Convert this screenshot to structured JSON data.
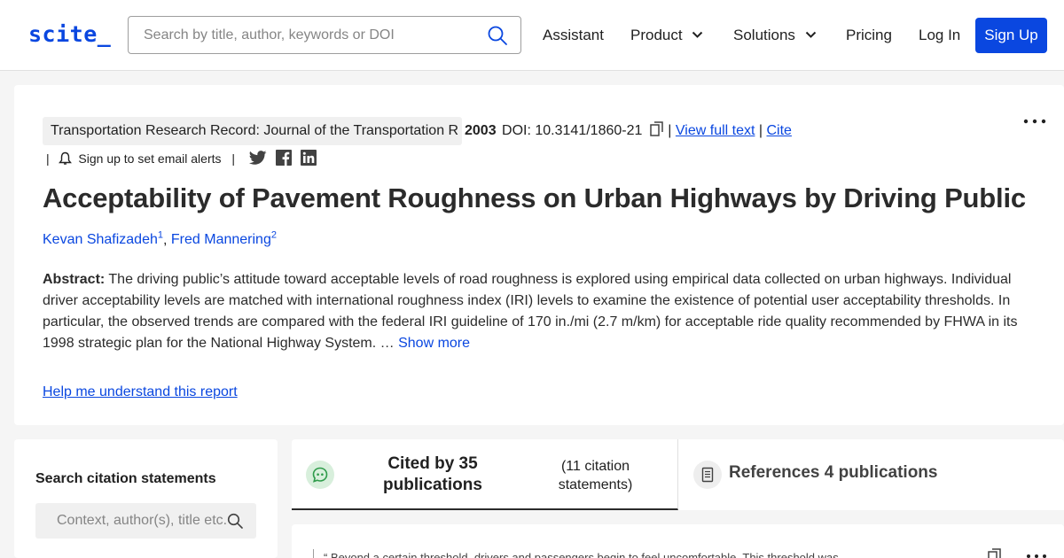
{
  "header": {
    "logo": "scite_",
    "search_placeholder": "Search by title, author, keywords or DOI",
    "nav": {
      "assistant": "Assistant",
      "product": "Product",
      "solutions": "Solutions",
      "pricing": "Pricing",
      "login": "Log In",
      "signup": "Sign Up"
    }
  },
  "paper": {
    "journal": "Transportation Research Record: Journal of the Transportation R",
    "year": "2003",
    "doi": "DOI: 10.3141/1860-21",
    "view_full_text": "View full text",
    "cite": "Cite",
    "alerts": "Sign up to set email alerts",
    "title": "Acceptability of Pavement Roughness on Urban Highways by Driving Public",
    "authors": [
      {
        "name": "Kevan Shafizadeh",
        "sup": "1"
      },
      {
        "name": "Fred Mannering",
        "sup": "2"
      }
    ],
    "abstract_label": "Abstract:",
    "abstract_text": "The driving public’s attitude toward acceptable levels of road roughness is explored using empirical data collected on urban highways. Individual driver acceptability levels are matched with international roughness index (IRI) levels to examine the existence of potential user acceptability thresholds. In particular, the observed trends are compared with the federal IRI guideline of 170 in./mi (2.7 m/km) for acceptable ride quality recommended by FHWA in its 1998 strategic plan for the National Highway System. …",
    "show_more": "Show more",
    "help_link": "Help me understand this report"
  },
  "citation_search": {
    "heading": "Search citation statements",
    "placeholder": "Context, author(s), title etc."
  },
  "tabs": {
    "cited_by": "Cited by 35 publications",
    "cited_statements": "(11 citation statements)",
    "references": "References 4 publications"
  },
  "citation_preview": {
    "text": "“ Beyond a certain threshold, drivers and passengers begin to feel uncomfortable. This threshold was"
  },
  "colors": {
    "accent": "#0a47e0",
    "cited_icon": "#2e9b4a"
  }
}
